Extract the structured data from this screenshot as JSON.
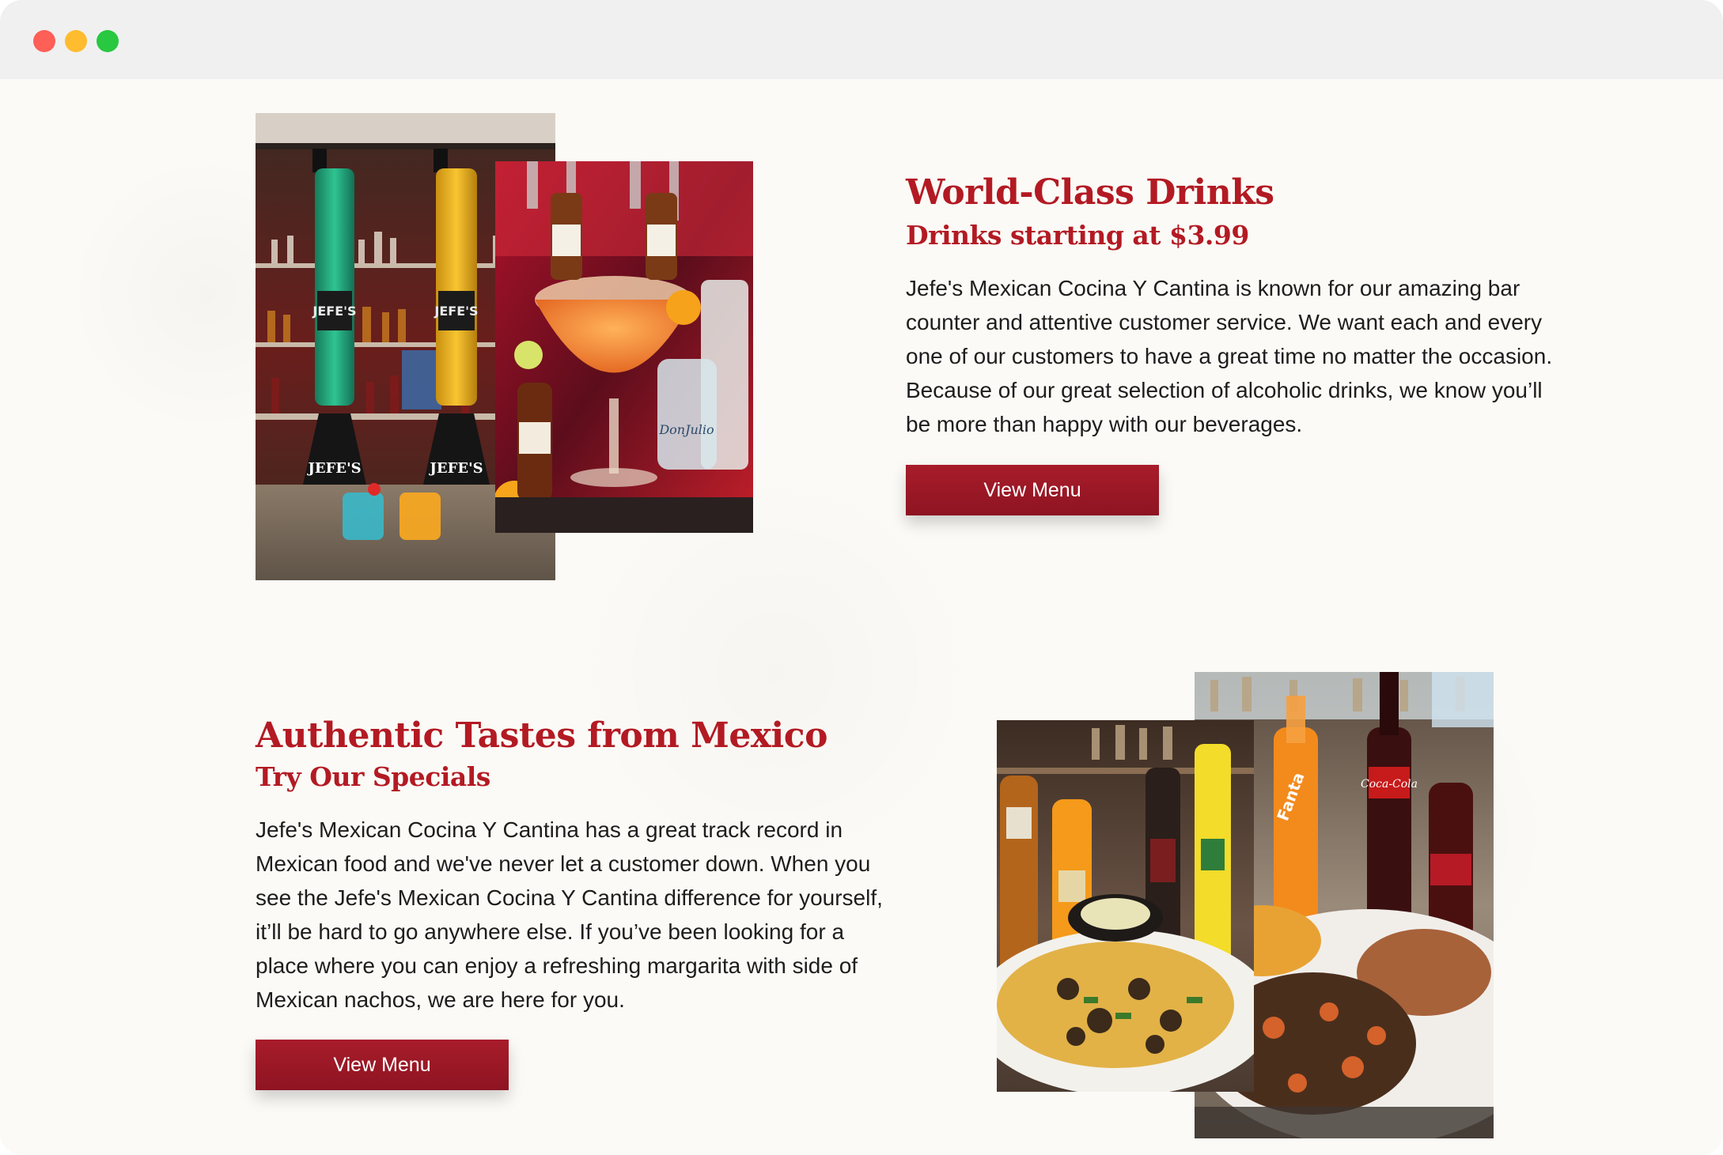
{
  "drinks": {
    "title": "World-Class Drinks",
    "subtitle": "Drinks starting at $3.99",
    "body": "Jefe's Mexican Cocina Y Cantina is known for our amazing bar counter and attentive customer service. We want each and every one of our customers to have a great time no matter the occasion. Because of our great selection of alcoholic drinks, we know you’ll be more than happy with our beverages.",
    "button_label": "View Menu"
  },
  "food": {
    "title": "Authentic Tastes from Mexico",
    "subtitle": "Try Our Specials",
    "body": "Jefe's Mexican Cocina Y Cantina has a great track record in Mexican food and we've never let a customer down. When you see the Jefe's Mexican Cocina Y Cantina difference for yourself, it’ll be hard to go anywhere else. If you’ve been looking for a place where you can enjoy a refreshing margarita with side of Mexican nachos, we are here for you.",
    "button_label": "View Menu"
  },
  "colors": {
    "accent": "#b31a23",
    "button": "#9c1826",
    "background": "#fbfaf6"
  }
}
